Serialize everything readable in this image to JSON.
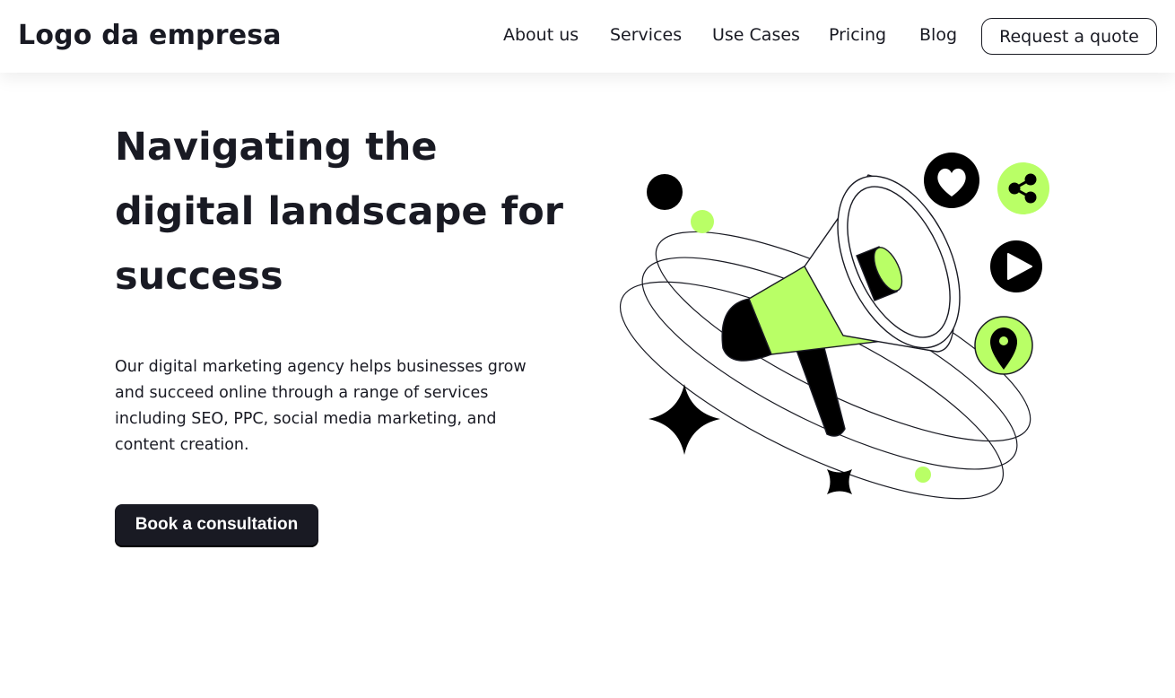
{
  "header": {
    "logo": "Logo da empresa",
    "nav": [
      {
        "label": "About us"
      },
      {
        "label": "Services"
      },
      {
        "label": "Use Cases"
      },
      {
        "label": "Pricing"
      },
      {
        "label": "Blog"
      }
    ],
    "cta_label": "Request a quote"
  },
  "hero": {
    "title": "Navigating the digital landscape for success",
    "description": "Our digital marketing agency helps businesses grow and succeed online through a range of services including SEO, PPC, social media marketing, and content creation.",
    "cta_label": "Book a consultation"
  },
  "illustration": {
    "icons": [
      "megaphone-icon",
      "heart-icon",
      "share-icon",
      "play-icon",
      "location-pin-icon",
      "sparkle-star-icon"
    ]
  },
  "colors": {
    "accent": "#b9ff66",
    "dark": "#191a23",
    "background": "#ffffff"
  }
}
